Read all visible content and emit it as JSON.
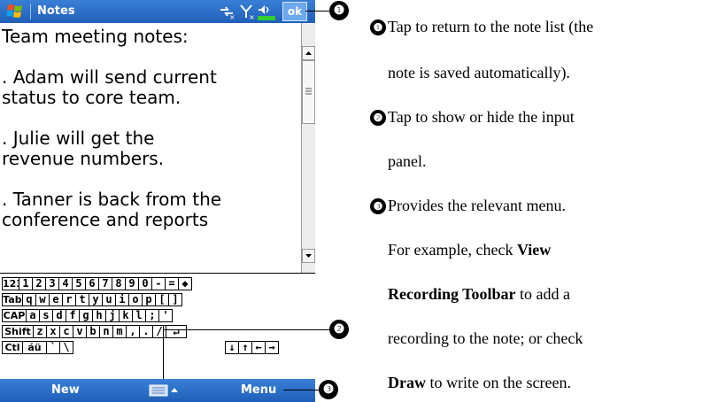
{
  "titlebar": {
    "app_name": "Notes",
    "ok_label": "ok"
  },
  "note": {
    "lines": [
      "Team meeting notes:",
      "",
      ". Adam will send current",
      "status to core team.",
      "",
      ". Julie will get the",
      "revenue numbers.",
      "",
      ". Tanner is back from the",
      "conference and reports"
    ]
  },
  "keyboard": {
    "rows": [
      [
        "123",
        "1",
        "2",
        "3",
        "4",
        "5",
        "6",
        "7",
        "8",
        "9",
        "0",
        "-",
        "=",
        "◆"
      ],
      [
        "Tab",
        "q",
        "w",
        "e",
        "r",
        "t",
        "y",
        "u",
        "i",
        "o",
        "p",
        "[",
        "]"
      ],
      [
        "CAP",
        "a",
        "s",
        "d",
        "f",
        "g",
        "h",
        "j",
        "k",
        "l",
        ";",
        "'"
      ],
      [
        "Shift",
        "z",
        "x",
        "c",
        "v",
        "b",
        "n",
        "m",
        ",",
        ".",
        "/",
        "↵"
      ],
      [
        "Ctl",
        "áü",
        "`",
        "\\",
        "↓",
        "↑",
        "←",
        "→"
      ]
    ]
  },
  "menubar": {
    "new_label": "New",
    "menu_label": "Menu"
  },
  "callouts": {
    "one": "❶",
    "two": "❷",
    "three": "❸"
  },
  "description": {
    "item1_line1": "Tap to return to the note list (the",
    "item1_line2": "note is saved automatically).",
    "item2_line1": "Tap to show or hide the input",
    "item2_line2": "panel.",
    "item3_line1": "Provides the relevant menu.",
    "item3_line2_pre": "For example, check ",
    "item3_line2_bold": "View",
    "item3_line3_bold": "Recording Toolbar",
    "item3_line3_post": " to add a",
    "item3_line4": "recording to the note; or check",
    "item3_line5_bold": "Draw",
    "item3_line5_post": " to write on the screen."
  },
  "colors": {
    "bar_blue": "#1f5fb8",
    "ok_blue": "#6da7ee",
    "battery_green": "#33cc33"
  }
}
